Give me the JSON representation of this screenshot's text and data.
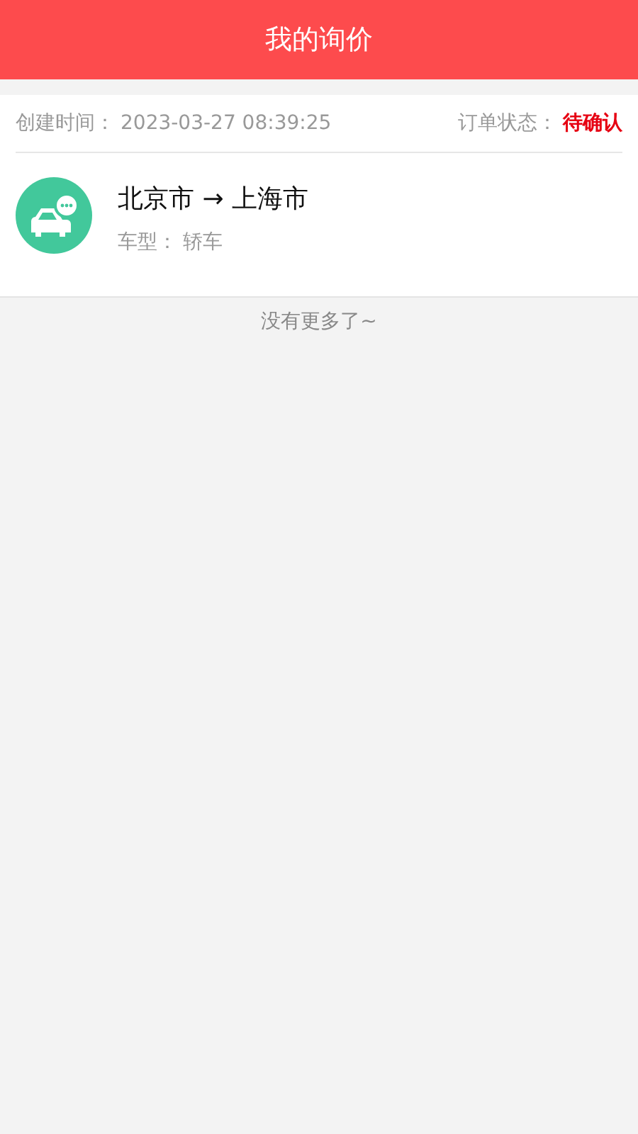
{
  "header": {
    "title": "我的询价"
  },
  "orders": [
    {
      "created_label": "创建时间：",
      "created_time": "2023-03-27 08:39:25",
      "status_label": "订单状态：",
      "status": "待确认",
      "route": "北京市 → 上海市",
      "car_type_label": "车型：",
      "car_type": "轿车"
    }
  ],
  "footer_note": "没有更多了~"
}
